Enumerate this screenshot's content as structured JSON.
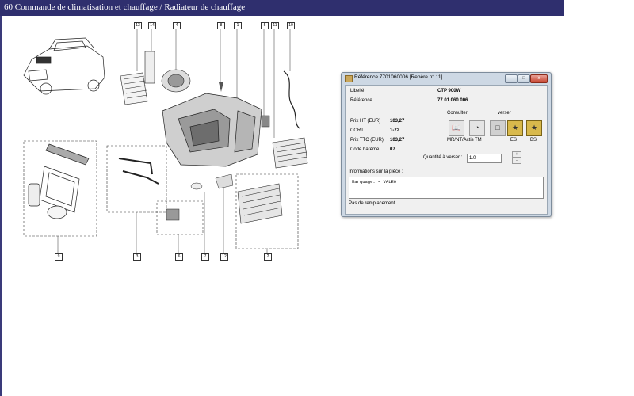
{
  "page": {
    "title": "60 Commande de climatisation et chauffage / Radiateur de chauffage"
  },
  "diagram": {
    "callouts": [
      "13",
      "14",
      "4",
      "8",
      "1",
      "5",
      "11",
      "10",
      "9",
      "3",
      "6",
      "7",
      "12",
      "2"
    ]
  },
  "dialog": {
    "title": "Référence 7701060006 [Repère n° 11]",
    "fields": [
      {
        "label": "Libellé",
        "value": "CTP 900W"
      },
      {
        "label": "Référence",
        "value": "77 01 060 006"
      }
    ],
    "prices": [
      {
        "label": "Prix HT (EUR)",
        "value": "103,27"
      },
      {
        "label": "CORT",
        "value": "1-72"
      },
      {
        "label": "Prix TTC (EUR)",
        "value": "103,27"
      },
      {
        "label": "Code barème",
        "value": "07"
      }
    ],
    "consulter_label": "Consulter",
    "verser_label": "verser",
    "buttons": [
      "MR/NT/Actis",
      "TM",
      "ES",
      "BS"
    ],
    "quantity_label": "Quantité à verser :",
    "quantity_value": "1.0",
    "info_label": "Informations sur la pièce :",
    "info_text": "Marquage: = VALEO",
    "status": "Pas de remplacement.",
    "window_buttons": {
      "minimize": "–",
      "maximize": "□",
      "close": "x"
    }
  },
  "colors": {
    "topbar": "#2f2f6e",
    "dialog_frame": "#cdd8e4",
    "icon_gold": "#d8b94c"
  }
}
